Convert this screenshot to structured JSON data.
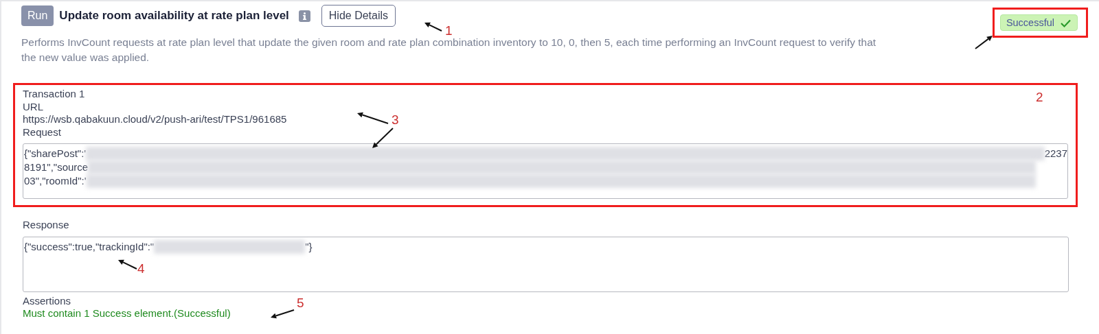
{
  "test": {
    "run_label": "Run",
    "title": "Update room availability at rate plan level",
    "details_button": "Hide Details",
    "description": "Performs InvCount requests at rate plan level that update the given room and rate plan combination inventory to 10, 0, then 5, each time performing an InvCount request to verify that the new value was applied.",
    "status": {
      "label": "Successful",
      "kind": "success"
    }
  },
  "transaction": {
    "title": "Transaction 1",
    "url_label": "URL",
    "url": "https://wsb.qabakuun.cloud/v2/push-ari/test/TPS1/961685",
    "request_label": "Request",
    "request_lines": [
      {
        "start": "{\"sharePost\":'",
        "end": "2237"
      },
      {
        "start": "8191\",\"source"
      },
      {
        "start": "03\",\"roomId\":'"
      }
    ]
  },
  "response": {
    "label": "Response",
    "start": "{\"success\":true,\"trackingId\":\"",
    "end": "\"}"
  },
  "assertions": {
    "label": "Assertions",
    "items": [
      {
        "text": "Must contain 1 Success element.(Successful)",
        "passed": true
      }
    ]
  },
  "callouts": [
    {
      "label": "1"
    },
    {
      "label": "2"
    },
    {
      "label": "3"
    },
    {
      "label": "4"
    },
    {
      "label": "5"
    }
  ]
}
